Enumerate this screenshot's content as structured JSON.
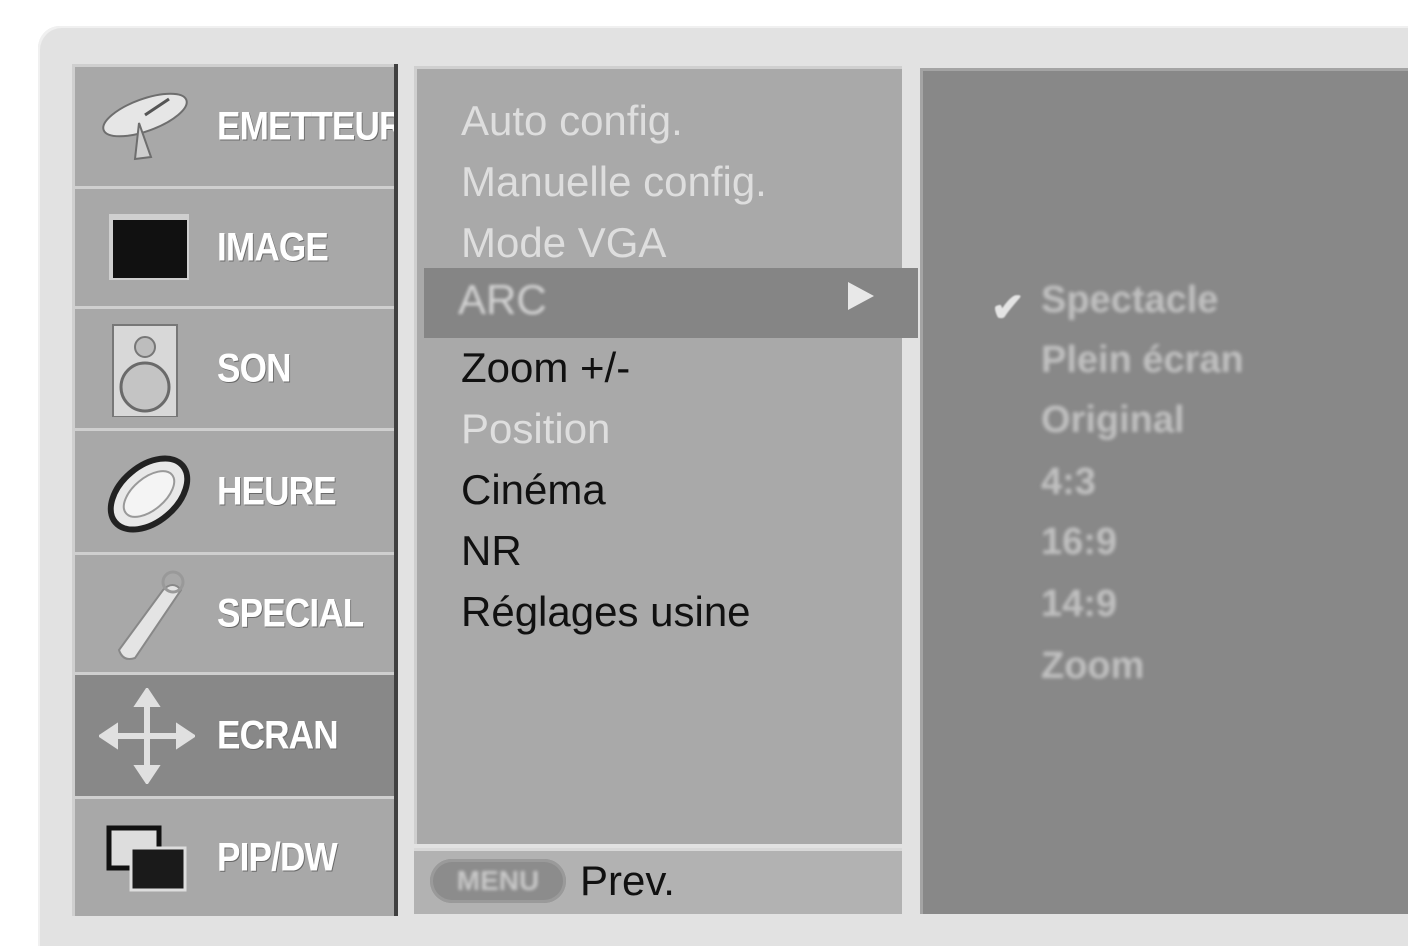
{
  "categories": [
    {
      "label": "EMETTEUR",
      "icon": "satellite-dish-icon",
      "selected": false
    },
    {
      "label": "IMAGE",
      "icon": "tv-screen-icon",
      "selected": false
    },
    {
      "label": "SON",
      "icon": "speaker-icon",
      "selected": false
    },
    {
      "label": "HEURE",
      "icon": "clock-icon",
      "selected": false
    },
    {
      "label": "SPECIAL",
      "icon": "remote-hand-icon",
      "selected": false
    },
    {
      "label": "ECRAN",
      "icon": "move-arrows-icon",
      "selected": true
    },
    {
      "label": "PIP/DW",
      "icon": "pip-windows-icon",
      "selected": false
    }
  ],
  "options": [
    {
      "label": "Auto config.",
      "enabled": false
    },
    {
      "label": "Manuelle config.",
      "enabled": false
    },
    {
      "label": "Mode VGA",
      "enabled": false
    },
    {
      "label": "ARC",
      "enabled": true,
      "highlighted": true
    },
    {
      "label": "Zoom +/-",
      "enabled": true
    },
    {
      "label": "Position",
      "enabled": false
    },
    {
      "label": "Cinéma",
      "enabled": true
    },
    {
      "label": "NR",
      "enabled": true
    },
    {
      "label": "Réglages usine",
      "enabled": true
    }
  ],
  "footer": {
    "key_label": "MENU",
    "action_label": "Prev."
  },
  "submenu": {
    "items": [
      "Spectacle",
      "Plein écran",
      "Original",
      "4:3",
      "16:9",
      "14:9",
      "Zoom"
    ],
    "checked_index": 0,
    "check_glyph": "✔"
  },
  "colors": {
    "category_bg": "#a8a8a8",
    "category_selected_bg": "#888888",
    "options_bg": "#a9a9a9",
    "highlight_bg": "#858585",
    "submenu_bg": "#888888"
  }
}
